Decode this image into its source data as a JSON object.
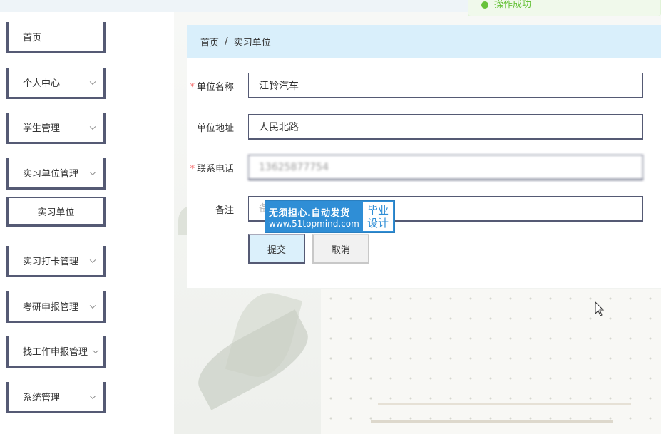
{
  "toast": {
    "message": "操作成功"
  },
  "sidebar": {
    "items": [
      {
        "label": "首页",
        "has_chevron": false
      },
      {
        "label": "个人中心",
        "has_chevron": true
      },
      {
        "label": "学生管理",
        "has_chevron": true
      },
      {
        "label": "实习单位管理",
        "has_chevron": true
      },
      {
        "label": "实习单位",
        "has_chevron": false,
        "submenu": true
      },
      {
        "label": "实习打卡管理",
        "has_chevron": true
      },
      {
        "label": "考研申报管理",
        "has_chevron": true
      },
      {
        "label": "找工作申报管理",
        "has_chevron": true
      },
      {
        "label": "系统管理",
        "has_chevron": true
      }
    ]
  },
  "breadcrumb": {
    "home": "首页",
    "separator": "/",
    "current": "实习单位"
  },
  "form": {
    "fields": [
      {
        "label": "单位名称",
        "required": true,
        "value": "江铃汽车",
        "placeholder": ""
      },
      {
        "label": "单位地址",
        "required": false,
        "value": "人民北路",
        "placeholder": ""
      },
      {
        "label": "联系电话",
        "required": true,
        "value": "13625877754",
        "placeholder": ""
      },
      {
        "label": "备注",
        "required": false,
        "value": "",
        "placeholder": "备注"
      }
    ],
    "submit_label": "提交",
    "cancel_label": "取消"
  },
  "watermark": {
    "line1": "无须担心.自动发货",
    "line2": "www.51topmind.com",
    "badge_line1": "毕业",
    "badge_line2": "设计"
  },
  "colors": {
    "menu_border": "#555a74",
    "breadcrumb_bg": "#d9effb",
    "required": "#f56c6c",
    "watermark_bg": "#2f8ed6",
    "toast_green": "#67c23a"
  }
}
